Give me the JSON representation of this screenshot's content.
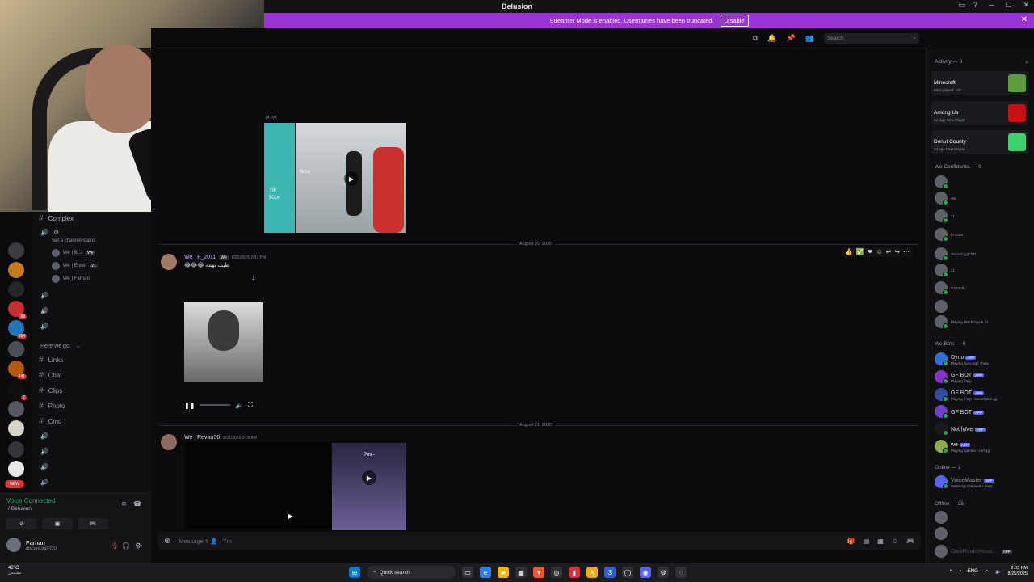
{
  "window": {
    "title": "Delusion"
  },
  "banner": {
    "text": "Streamer Mode is enabled. Usernames have been truncated.",
    "disable_label": "Disable"
  },
  "topbar": {
    "search_placeholder": "Search"
  },
  "servers": [
    {
      "badge": ""
    },
    {
      "badge": ""
    },
    {
      "badge": ""
    },
    {
      "badge": ""
    },
    {
      "badge": "68"
    },
    {
      "badge": "164"
    },
    {
      "badge": ""
    },
    {
      "badge": "241"
    },
    {
      "badge": "7"
    },
    {
      "badge": ""
    },
    {
      "badge": ""
    },
    {
      "badge": ""
    },
    {
      "badge": ""
    },
    {
      "badge": "NEW"
    }
  ],
  "channels": {
    "complex": "Complex",
    "set_status": "Set a channel status",
    "voice_users": [
      {
        "name": "We | B..J",
        "tag": "We"
      },
      {
        "name": "We | Enteif",
        "tag": "21"
      },
      {
        "name": "We | Farhan",
        "tag": ""
      }
    ],
    "category": "Here we go.",
    "text_channels": [
      "Links",
      "Chat",
      "Clips",
      "Photo",
      "Cmd"
    ]
  },
  "user_panel": {
    "voice_status": "Voice Connected",
    "voice_channel": "/ Delusion",
    "username": "Farhan",
    "status": "discord.gg/FDD"
  },
  "chat": {
    "first_ts": "14 PM",
    "date1": "August 20, 2025",
    "msg1": {
      "author": "We | F_2011",
      "tag": "We",
      "time": "8/20/2025 2:37 PM",
      "text": "😂😂😂 طيب تهمه"
    },
    "date2": "August 21, 2025",
    "msg2": {
      "author": "We | Revan56",
      "time": "8/21/2025 9:05 AM"
    },
    "media_top_text": "Tik",
    "media_top_sub": "80zx",
    "tiktok_label": "TikTok",
    "pov_label": "Pov -",
    "composer_placeholder": "Message #",
    "composer_suffix": "Tm"
  },
  "members": {
    "activity_header": "Activity — 9",
    "activities": [
      {
        "title": "Minecraft",
        "sub": "Most played: 11h",
        "color": "#5d9c3a"
      },
      {
        "title": "Among Us",
        "sub": "5w ago  New Player",
        "color": "#c51111"
      },
      {
        "title": "Donut County",
        "sub": "2d ago  New Player",
        "color": "#3bd16f"
      }
    ],
    "confidants_header": "We Confidants. — 9",
    "confidants": [
      {
        "sub": ""
      },
      {
        "sub": "We"
      },
      {
        "sub": "21"
      },
      {
        "sub": "In voice"
      },
      {
        "sub": "discord.gg/FDD"
      },
      {
        "sub": "21"
      },
      {
        "sub": "GG/Sn0"
      },
      {
        "sub": ""
      },
      {
        "sub": "Playing Black Ops 6 +1"
      }
    ],
    "bots_header": "We Bots — 6",
    "bots": [
      {
        "name": "Dyno",
        "sub": "Playing dyno.gg | ?help"
      },
      {
        "name": "GF BOT",
        "sub": "Playing /help"
      },
      {
        "name": "GF BOT",
        "sub": "Playing /help | securitybot.gg"
      },
      {
        "name": "GF BOT",
        "sub": ""
      },
      {
        "name": "NotifyMe",
        "sub": ""
      },
      {
        "name": "we",
        "sub": "Playing /games | carl.gg"
      }
    ],
    "app_tag": "APP",
    "online_header": "Online — 1",
    "online": [
      {
        "name": "VoiceMaster",
        "sub": "Watching channels • /help"
      }
    ],
    "offline_header": "Offline — 25",
    "offline_last": "DarkRealmHosti..."
  },
  "taskbar": {
    "temp": "42°C",
    "weather_sub": "مشمس",
    "search": "Quick search",
    "lang": "ENG",
    "time": "2:03 PM",
    "date": "8/25/2025"
  }
}
